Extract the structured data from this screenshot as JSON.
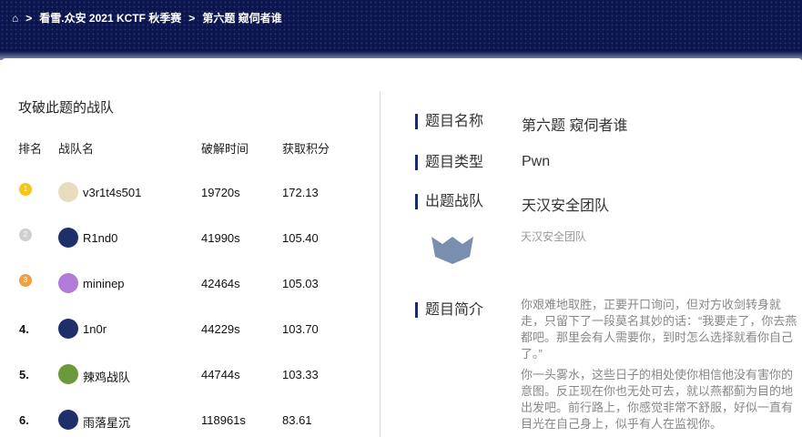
{
  "breadcrumb": {
    "home_icon": "home-icon",
    "items": [
      "看雪.众安 2021 KCTF 秋季赛",
      "第六题 窥伺者谁"
    ],
    "sep": ">"
  },
  "left": {
    "title": "攻破此题的战队",
    "headers": [
      "排名",
      "战队名",
      "破解时间",
      "获取积分"
    ],
    "rows": [
      {
        "rank": "1",
        "team": "v3r1t4s501",
        "time": "19720s",
        "score": "172.13",
        "medal": "#f5c518",
        "avatar": "#e8dcc0"
      },
      {
        "rank": "2",
        "team": "R1nd0",
        "time": "41990s",
        "score": "105.40",
        "medal": "#cfcfcf",
        "avatar": "#1f2f6a"
      },
      {
        "rank": "3",
        "team": "mininep",
        "time": "42464s",
        "score": "105.03",
        "medal": "#f0a040",
        "avatar": "#b07cd8"
      },
      {
        "rank": "4.",
        "team": "1n0r",
        "time": "44229s",
        "score": "103.70",
        "avatar": "#1f2f6a"
      },
      {
        "rank": "5.",
        "team": "辣鸡战队",
        "time": "44744s",
        "score": "103.33",
        "avatar": "#6a9a3a"
      },
      {
        "rank": "6.",
        "team": "雨落星沉",
        "time": "118961s",
        "score": "83.61",
        "avatar": "#1f2f6a"
      }
    ]
  },
  "right": {
    "name_label": "题目名称",
    "name": "第六题 窥伺者谁",
    "type_label": "题目类型",
    "type": "Pwn",
    "team_label": "出题战队",
    "team": "天汉安全团队",
    "team_caption": "天汉安全团队",
    "intro_label": "题目简介",
    "intro_p1": "你艰难地取胜，正要开口询问，但对方收剑转身就走，只留下了一段莫名其妙的话：“我要走了，你去燕都吧。那里会有人需要你，到时怎么选择就看你自己了。”",
    "intro_p2": "你一头雾水，这些日子的相处使你相信他没有害你的意图。反正现在你也无处可去，就以燕都蓟为目的地出发吧。前行路上，你感觉非常不舒服，好似一直有目光在自己身上，似乎有人在监视你。"
  }
}
